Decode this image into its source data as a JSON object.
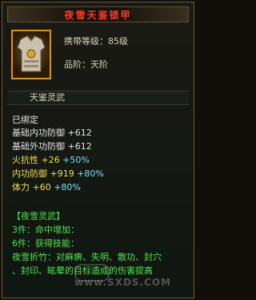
{
  "title": "夜雪天鉴锁甲",
  "item": {
    "level_line": "携带等级：85级",
    "grade_line": "品阶：天阶"
  },
  "subtitle": "天鉴灵武",
  "bound": "已绑定",
  "stats": [
    {
      "name": "基础内功防御",
      "value": "+612",
      "bonus": ""
    },
    {
      "name": "基础外功防御",
      "value": "+612",
      "bonus": ""
    },
    {
      "name": "火抗性",
      "value": "+26",
      "bonus": "+50%"
    },
    {
      "name": "内功防御",
      "value": "+919",
      "bonus": "+80%"
    },
    {
      "name": "体力",
      "value": "+60",
      "bonus": "+80%"
    }
  ],
  "set": {
    "name": "【夜雪灵武】",
    "bonus3": "3件：命中增加：",
    "bonus6": "6件：获得技能：",
    "skill_line1": "夜雪折竹：对麻痹、失明、散功、封穴",
    "skill_line2": "、封印、眩晕的目标造成的伤害提高"
  },
  "watermark": "www.SXDS.COM",
  "colors": {
    "title": "#ff3a24",
    "stat_white": "#e4e4e4",
    "stat_yellow": "#f0e040",
    "bonus_cyan": "#6fe0f0",
    "set_green": "#48e848",
    "icon_border": "#d89422"
  }
}
